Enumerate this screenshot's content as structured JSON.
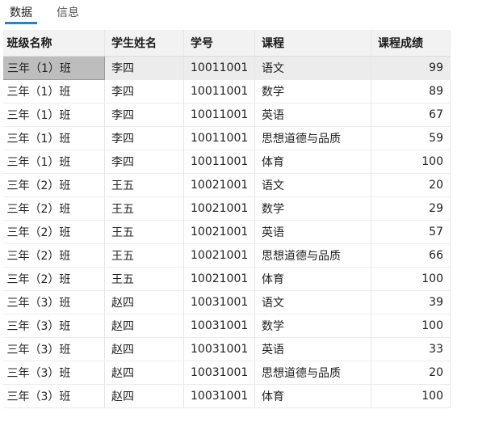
{
  "tabs": [
    {
      "label": "数据",
      "active": true
    },
    {
      "label": "信息",
      "active": false
    }
  ],
  "table": {
    "columns": [
      "班级名称",
      "学生姓名",
      "学号",
      "课程",
      "课程成绩"
    ],
    "rows": [
      [
        "三年（1）班",
        "李四",
        "10011001",
        "语文",
        "99"
      ],
      [
        "三年（1）班",
        "李四",
        "10011001",
        "数学",
        "89"
      ],
      [
        "三年（1）班",
        "李四",
        "10011001",
        "英语",
        "67"
      ],
      [
        "三年（1）班",
        "李四",
        "10011001",
        "思想道德与品质",
        "59"
      ],
      [
        "三年（1）班",
        "李四",
        "10011001",
        "体育",
        "100"
      ],
      [
        "三年（2）班",
        "王五",
        "10021001",
        "语文",
        "20"
      ],
      [
        "三年（2）班",
        "王五",
        "10021001",
        "数学",
        "29"
      ],
      [
        "三年（2）班",
        "王五",
        "10021001",
        "英语",
        "57"
      ],
      [
        "三年（2）班",
        "王五",
        "10021001",
        "思想道德与品质",
        "66"
      ],
      [
        "三年（2）班",
        "王五",
        "10021001",
        "体育",
        "100"
      ],
      [
        "三年（3）班",
        "赵四",
        "10031001",
        "语文",
        "39"
      ],
      [
        "三年（3）班",
        "赵四",
        "10031001",
        "数学",
        "100"
      ],
      [
        "三年（3）班",
        "赵四",
        "10031001",
        "英语",
        "33"
      ],
      [
        "三年（3）班",
        "赵四",
        "10031001",
        "思想道德与品质",
        "20"
      ],
      [
        "三年（3）班",
        "赵四",
        "10031001",
        "体育",
        "100"
      ]
    ]
  },
  "colors": {
    "tab_accent": "#1e88c9",
    "header_bg": "#f2f2f2",
    "selected_row_bg": "#ececec",
    "selected_cell_bg": "#bdbdbd"
  }
}
